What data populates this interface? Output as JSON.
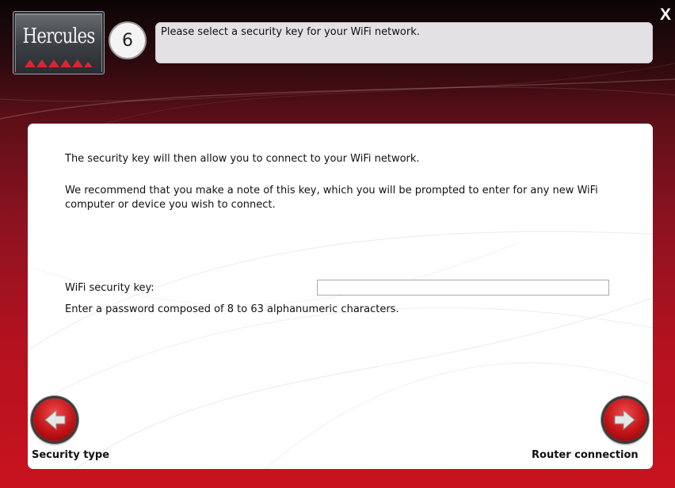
{
  "header": {
    "logo_text": "Hercules",
    "step_number": "6",
    "title": "Please select a security key for your WiFi network.",
    "close_label": "X"
  },
  "main": {
    "intro": "The security key will then allow you to connect to your WiFi network.",
    "note": "We recommend that you make a note of this key, which you will be prompted to enter for any new WiFi computer or device you wish to connect.",
    "key_label": "WiFi security key:",
    "key_value": "",
    "key_hint": "Enter a password composed of 8 to 63 alphanumeric characters."
  },
  "nav": {
    "back_label": "Security type",
    "back_icon": "arrow-left-icon",
    "next_label": "Router connection",
    "next_icon": "arrow-right-icon"
  },
  "colors": {
    "accent_red": "#c9131f",
    "panel": "#ffffff",
    "title_bar": "#e3e1e3"
  }
}
